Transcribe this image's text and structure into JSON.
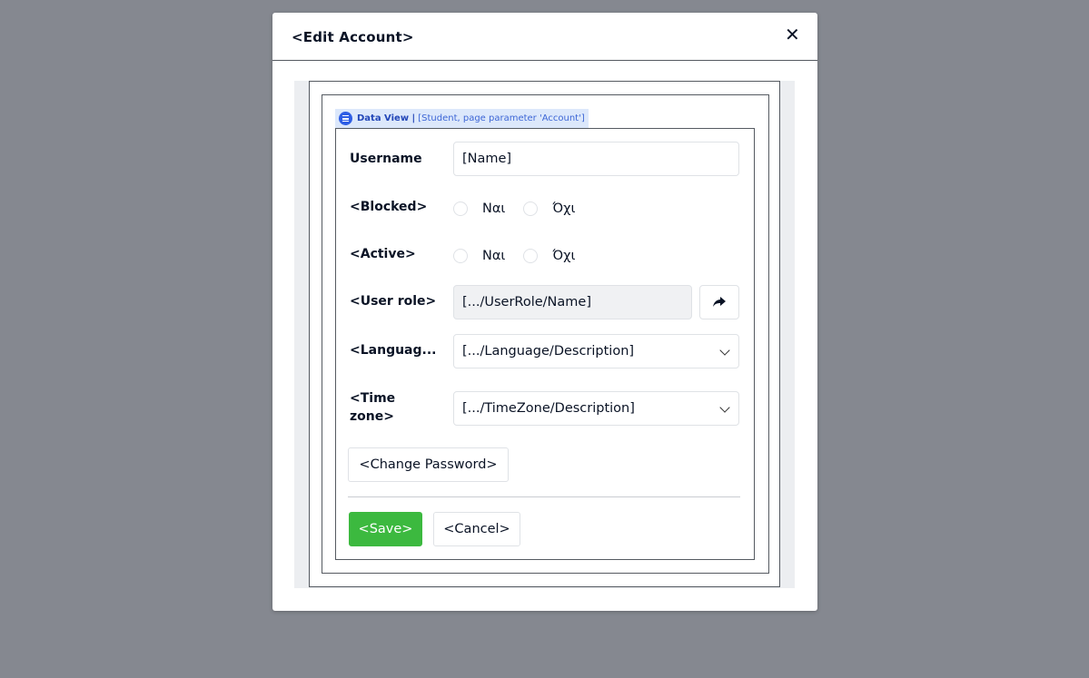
{
  "dialog": {
    "title": "<Edit Account>",
    "close_icon": "close-icon"
  },
  "data_view": {
    "name": "Data View |",
    "context": "[Student, page parameter 'Account']",
    "icon": "database-icon",
    "color": "#2e5ee5"
  },
  "form": {
    "username": {
      "label": "Username",
      "value": "[Name]"
    },
    "blocked": {
      "label": "<Blocked>",
      "options": [
        "Ναι",
        "Όχι"
      ]
    },
    "active": {
      "label": "<Active>",
      "options": [
        "Ναι",
        "Όχι"
      ]
    },
    "user_role": {
      "label": "<User role>",
      "value": "[.../UserRole/Name]",
      "button_icon": "share-arrow-icon"
    },
    "language": {
      "label": "<Languag...",
      "value": "[.../Language/Description]"
    },
    "time_zone": {
      "label_line1": "<Time",
      "label_line2": "zone>",
      "value": "[.../TimeZone/Description]"
    },
    "change_password_label": "<Change Password>"
  },
  "footer": {
    "save_label": "<Save>",
    "cancel_label": "<Cancel>",
    "save_color": "#3cb93f"
  }
}
